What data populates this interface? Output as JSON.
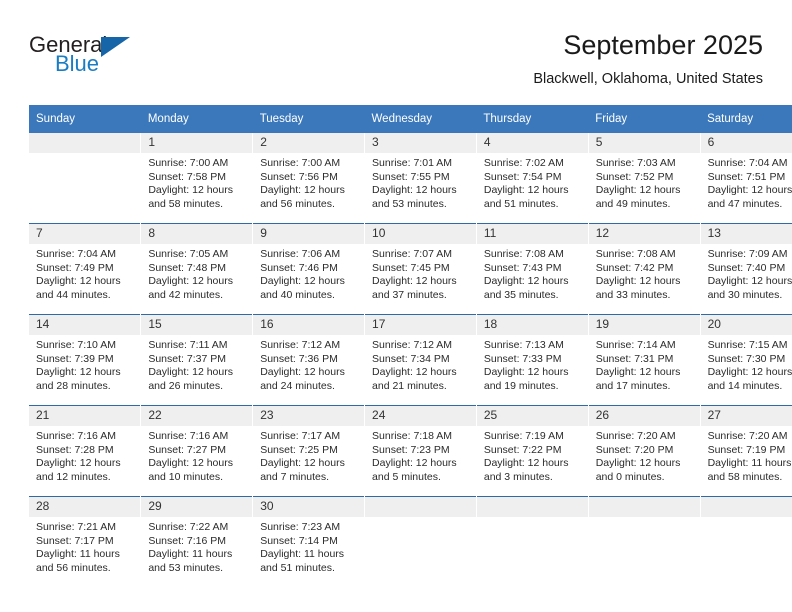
{
  "logo": {
    "word_top": "General",
    "word_bottom": "Blue",
    "triangle_icon": "triangle-icon",
    "brand_blue": "#1a7dc4",
    "brand_dark_blue": "#1565a8"
  },
  "header": {
    "month_title": "September 2025",
    "location": "Blackwell, Oklahoma, United States"
  },
  "colors": {
    "header_band": "#3a78bb",
    "row_divider": "#2f6aa8",
    "daynum_band": "#efefef"
  },
  "calendar": {
    "weekday_headers": [
      "Sunday",
      "Monday",
      "Tuesday",
      "Wednesday",
      "Thursday",
      "Friday",
      "Saturday"
    ],
    "weeks": [
      [
        {
          "day": "",
          "lines": []
        },
        {
          "day": "1",
          "lines": [
            "Sunrise: 7:00 AM",
            "Sunset: 7:58 PM",
            "Daylight: 12 hours",
            "and 58 minutes."
          ]
        },
        {
          "day": "2",
          "lines": [
            "Sunrise: 7:00 AM",
            "Sunset: 7:56 PM",
            "Daylight: 12 hours",
            "and 56 minutes."
          ]
        },
        {
          "day": "3",
          "lines": [
            "Sunrise: 7:01 AM",
            "Sunset: 7:55 PM",
            "Daylight: 12 hours",
            "and 53 minutes."
          ]
        },
        {
          "day": "4",
          "lines": [
            "Sunrise: 7:02 AM",
            "Sunset: 7:54 PM",
            "Daylight: 12 hours",
            "and 51 minutes."
          ]
        },
        {
          "day": "5",
          "lines": [
            "Sunrise: 7:03 AM",
            "Sunset: 7:52 PM",
            "Daylight: 12 hours",
            "and 49 minutes."
          ]
        },
        {
          "day": "6",
          "lines": [
            "Sunrise: 7:04 AM",
            "Sunset: 7:51 PM",
            "Daylight: 12 hours",
            "and 47 minutes."
          ]
        }
      ],
      [
        {
          "day": "7",
          "lines": [
            "Sunrise: 7:04 AM",
            "Sunset: 7:49 PM",
            "Daylight: 12 hours",
            "and 44 minutes."
          ]
        },
        {
          "day": "8",
          "lines": [
            "Sunrise: 7:05 AM",
            "Sunset: 7:48 PM",
            "Daylight: 12 hours",
            "and 42 minutes."
          ]
        },
        {
          "day": "9",
          "lines": [
            "Sunrise: 7:06 AM",
            "Sunset: 7:46 PM",
            "Daylight: 12 hours",
            "and 40 minutes."
          ]
        },
        {
          "day": "10",
          "lines": [
            "Sunrise: 7:07 AM",
            "Sunset: 7:45 PM",
            "Daylight: 12 hours",
            "and 37 minutes."
          ]
        },
        {
          "day": "11",
          "lines": [
            "Sunrise: 7:08 AM",
            "Sunset: 7:43 PM",
            "Daylight: 12 hours",
            "and 35 minutes."
          ]
        },
        {
          "day": "12",
          "lines": [
            "Sunrise: 7:08 AM",
            "Sunset: 7:42 PM",
            "Daylight: 12 hours",
            "and 33 minutes."
          ]
        },
        {
          "day": "13",
          "lines": [
            "Sunrise: 7:09 AM",
            "Sunset: 7:40 PM",
            "Daylight: 12 hours",
            "and 30 minutes."
          ]
        }
      ],
      [
        {
          "day": "14",
          "lines": [
            "Sunrise: 7:10 AM",
            "Sunset: 7:39 PM",
            "Daylight: 12 hours",
            "and 28 minutes."
          ]
        },
        {
          "day": "15",
          "lines": [
            "Sunrise: 7:11 AM",
            "Sunset: 7:37 PM",
            "Daylight: 12 hours",
            "and 26 minutes."
          ]
        },
        {
          "day": "16",
          "lines": [
            "Sunrise: 7:12 AM",
            "Sunset: 7:36 PM",
            "Daylight: 12 hours",
            "and 24 minutes."
          ]
        },
        {
          "day": "17",
          "lines": [
            "Sunrise: 7:12 AM",
            "Sunset: 7:34 PM",
            "Daylight: 12 hours",
            "and 21 minutes."
          ]
        },
        {
          "day": "18",
          "lines": [
            "Sunrise: 7:13 AM",
            "Sunset: 7:33 PM",
            "Daylight: 12 hours",
            "and 19 minutes."
          ]
        },
        {
          "day": "19",
          "lines": [
            "Sunrise: 7:14 AM",
            "Sunset: 7:31 PM",
            "Daylight: 12 hours",
            "and 17 minutes."
          ]
        },
        {
          "day": "20",
          "lines": [
            "Sunrise: 7:15 AM",
            "Sunset: 7:30 PM",
            "Daylight: 12 hours",
            "and 14 minutes."
          ]
        }
      ],
      [
        {
          "day": "21",
          "lines": [
            "Sunrise: 7:16 AM",
            "Sunset: 7:28 PM",
            "Daylight: 12 hours",
            "and 12 minutes."
          ]
        },
        {
          "day": "22",
          "lines": [
            "Sunrise: 7:16 AM",
            "Sunset: 7:27 PM",
            "Daylight: 12 hours",
            "and 10 minutes."
          ]
        },
        {
          "day": "23",
          "lines": [
            "Sunrise: 7:17 AM",
            "Sunset: 7:25 PM",
            "Daylight: 12 hours",
            "and 7 minutes."
          ]
        },
        {
          "day": "24",
          "lines": [
            "Sunrise: 7:18 AM",
            "Sunset: 7:23 PM",
            "Daylight: 12 hours",
            "and 5 minutes."
          ]
        },
        {
          "day": "25",
          "lines": [
            "Sunrise: 7:19 AM",
            "Sunset: 7:22 PM",
            "Daylight: 12 hours",
            "and 3 minutes."
          ]
        },
        {
          "day": "26",
          "lines": [
            "Sunrise: 7:20 AM",
            "Sunset: 7:20 PM",
            "Daylight: 12 hours",
            "and 0 minutes."
          ]
        },
        {
          "day": "27",
          "lines": [
            "Sunrise: 7:20 AM",
            "Sunset: 7:19 PM",
            "Daylight: 11 hours",
            "and 58 minutes."
          ]
        }
      ],
      [
        {
          "day": "28",
          "lines": [
            "Sunrise: 7:21 AM",
            "Sunset: 7:17 PM",
            "Daylight: 11 hours",
            "and 56 minutes."
          ]
        },
        {
          "day": "29",
          "lines": [
            "Sunrise: 7:22 AM",
            "Sunset: 7:16 PM",
            "Daylight: 11 hours",
            "and 53 minutes."
          ]
        },
        {
          "day": "30",
          "lines": [
            "Sunrise: 7:23 AM",
            "Sunset: 7:14 PM",
            "Daylight: 11 hours",
            "and 51 minutes."
          ]
        },
        {
          "day": "",
          "lines": []
        },
        {
          "day": "",
          "lines": []
        },
        {
          "day": "",
          "lines": []
        },
        {
          "day": "",
          "lines": []
        }
      ]
    ]
  }
}
